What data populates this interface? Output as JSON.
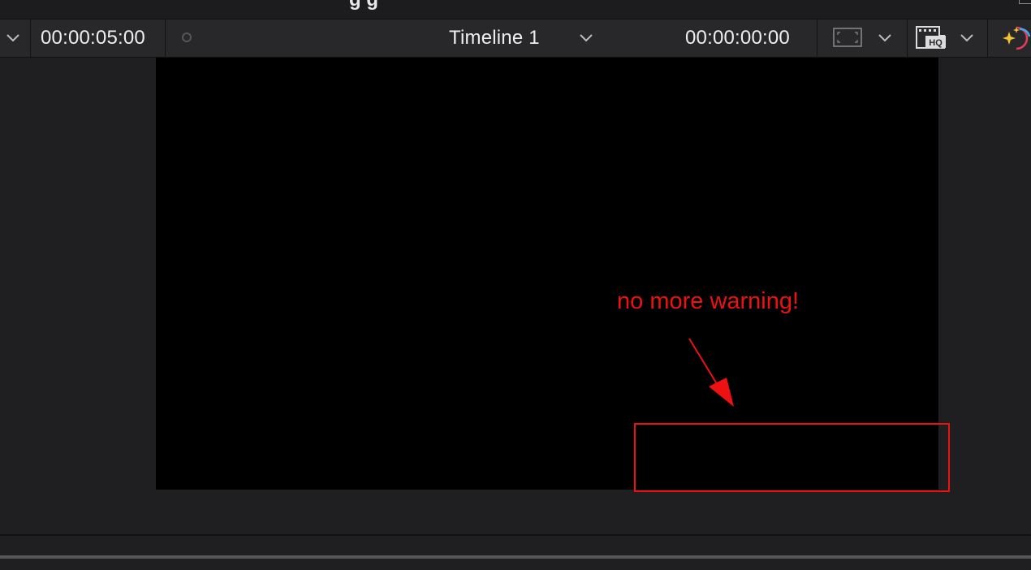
{
  "window": {
    "title_partial": "g g"
  },
  "toolbar": {
    "source_timecode": "00:00:05:00",
    "timeline_name": "Timeline 1",
    "record_timecode": "00:00:00:00",
    "icons": [
      "chevron-down-icon",
      "dot-icon",
      "frame-icon",
      "hq-icon",
      "effects-icon"
    ]
  },
  "annotation": {
    "text": "no more warning!",
    "color": "#ee1111"
  },
  "colors": {
    "background": "#1f1f21",
    "toolbar": "#28282b",
    "viewer": "#000000"
  }
}
